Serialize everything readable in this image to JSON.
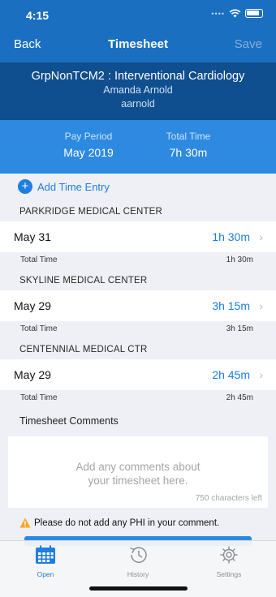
{
  "status": {
    "time": "4:15",
    "dots": "••••"
  },
  "nav": {
    "back": "Back",
    "title": "Timesheet",
    "save": "Save"
  },
  "header": {
    "department": "GrpNonTCM2 : Interventional Cardiology",
    "name": "Amanda Arnold",
    "username": "aarnold"
  },
  "summary": {
    "pay_period_label": "Pay Period",
    "pay_period_value": "May 2019",
    "total_time_label": "Total Time",
    "total_time_value": "7h 30m"
  },
  "add_entry": {
    "label": "Add Time Entry",
    "icon": "plus-icon"
  },
  "groups": [
    {
      "facility": "PARKRIDGE MEDICAL CENTER",
      "date": "May 31",
      "time": "1h 30m",
      "total_label": "Total Time",
      "total_value": "1h 30m"
    },
    {
      "facility": "SKYLINE MEDICAL CENTER",
      "date": "May 29",
      "time": "3h 15m",
      "total_label": "Total Time",
      "total_value": "3h 15m"
    },
    {
      "facility": "CENTENNIAL MEDICAL CTR",
      "date": "May 29",
      "time": "2h 45m",
      "total_label": "Total Time",
      "total_value": "2h 45m"
    }
  ],
  "comments": {
    "label": "Timesheet Comments",
    "placeholder_line1": "Add any comments about",
    "placeholder_line2": "your timesheet here.",
    "chars_left": "750 characters left"
  },
  "warning": {
    "text": "Please do not add any PHI in your comment.",
    "icon": "warning-icon"
  },
  "tabs": [
    {
      "label": "Open",
      "icon": "calendar-icon",
      "active": true
    },
    {
      "label": "History",
      "icon": "history-icon",
      "active": false
    },
    {
      "label": "Settings",
      "icon": "gear-icon",
      "active": false
    }
  ],
  "colors": {
    "nav_blue": "#1b6fc0",
    "dark_blue": "#0f4e8f",
    "mid_blue": "#2e8ae0",
    "accent": "#1f7ee0",
    "background": "#eef0f5"
  }
}
